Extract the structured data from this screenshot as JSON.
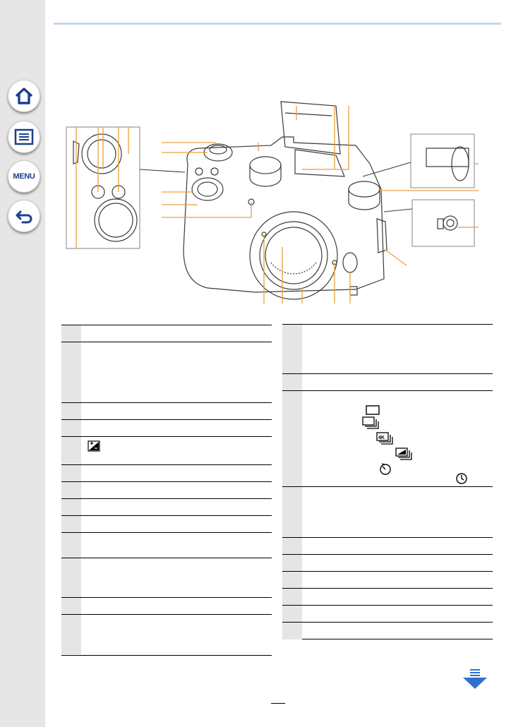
{
  "sidebar": {
    "buttons": [
      {
        "name": "home-button",
        "icon": "home-icon"
      },
      {
        "name": "contents-button",
        "icon": "list-icon"
      },
      {
        "name": "menu-button",
        "icon": "menu-icon",
        "label": "MENU"
      },
      {
        "name": "back-button",
        "icon": "back-arrow-icon"
      }
    ]
  },
  "colors": {
    "accent": "#e8a23a",
    "nav_blue": "#1b3f8f",
    "next_arrow": "#2f6fd0",
    "sidebar": "#e6e6e6",
    "table_number_cell": "#e5e5e5"
  },
  "figure": {
    "icons": [
      "single-drive-icon",
      "burst-icon",
      "4k-photo-icon",
      "auto-bracket-icon",
      "self-timer-icon",
      "time-lapse-icon",
      "exposure-compensation-icon"
    ]
  },
  "table_left": {
    "rows": [
      {
        "height": 24
      },
      {
        "height": 86
      },
      {
        "height": 24
      },
      {
        "height": 24
      },
      {
        "height": 40
      },
      {
        "height": 24
      },
      {
        "height": 24
      },
      {
        "height": 24
      },
      {
        "height": 24
      },
      {
        "height": 36
      },
      {
        "height": 56
      },
      {
        "height": 24
      },
      {
        "height": 56
      }
    ]
  },
  "table_right": {
    "rows": [
      {
        "height": 70
      },
      {
        "height": 24
      },
      {
        "height": 136
      },
      {
        "height": 72
      },
      {
        "height": 24
      },
      {
        "height": 24
      },
      {
        "height": 24
      },
      {
        "height": 24
      },
      {
        "height": 24
      },
      {
        "height": 24
      }
    ]
  }
}
